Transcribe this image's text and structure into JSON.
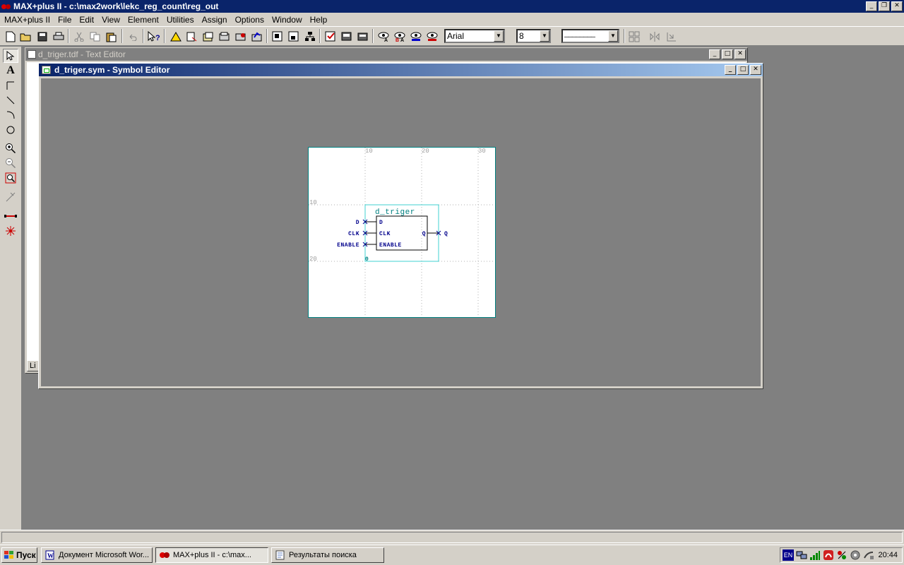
{
  "app": {
    "title": "MAX+plus II - c:\\max2work\\lekc_reg_count\\reg_out"
  },
  "window_controls": {
    "minimize": "_",
    "restore": "❐",
    "maximize": "□",
    "close": "✕"
  },
  "menu": [
    "MAX+plus II",
    "File",
    "Edit",
    "View",
    "Element",
    "Utilities",
    "Assign",
    "Options",
    "Window",
    "Help"
  ],
  "toolbar": {
    "font_name": "Arial",
    "font_size": "8",
    "line_style": "────────"
  },
  "text_editor": {
    "title": "d_triger.tdf - Text Editor",
    "status_tab": "Li"
  },
  "symbol_editor": {
    "title": "d_triger.sym - Symbol Editor",
    "grid_labels_top": [
      "10",
      "20",
      "30"
    ],
    "grid_labels_left": [
      "10",
      "20"
    ],
    "symbol": {
      "name": "d_triger",
      "origin_label": "0",
      "inputs": [
        {
          "outer": "D",
          "inner": "D"
        },
        {
          "outer": "CLK",
          "inner": "CLK"
        },
        {
          "outer": "ENABLE",
          "inner": "ENABLE"
        }
      ],
      "outputs": [
        {
          "outer": "Q",
          "inner": "Q"
        }
      ]
    }
  },
  "taskbar": {
    "start_label": "Пуск",
    "buttons": [
      {
        "label": "Документ Microsoft Wor..."
      },
      {
        "label": "MAX+plus II - c:\\max..."
      },
      {
        "label": "Результаты поиска"
      }
    ],
    "tray_lang": "EN",
    "clock": "20:44"
  },
  "colors": {
    "active_title": "#0a246a",
    "inactive_title": "#808080",
    "symbol_teal": "#00a0a0",
    "pin_blue": "#00008b"
  }
}
